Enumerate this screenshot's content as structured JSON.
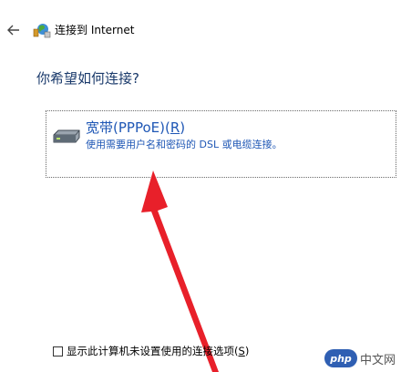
{
  "header": {
    "back_icon": "arrow-left-icon",
    "app_icon": "globe-network-icon",
    "title": "连接到 Internet"
  },
  "main": {
    "question": "你希望如何连接?",
    "options": [
      {
        "icon": "modem-icon",
        "title": "宽带(PPPoE)(",
        "accelerator": "R",
        "title_end": ")",
        "description": "使用需要用户名和密码的 DSL 或电缆连接。"
      }
    ]
  },
  "footer": {
    "checkbox_checked": false,
    "checkbox_label": "显示此计算机未设置使用的连接选项(",
    "checkbox_accelerator": "S",
    "checkbox_label_end": ")"
  },
  "watermark": {
    "badge": "php",
    "text": "中文网"
  },
  "colors": {
    "link_blue": "#1f57b5",
    "heading_blue": "#1a3a6b",
    "annotation_red": "#e8202a"
  }
}
